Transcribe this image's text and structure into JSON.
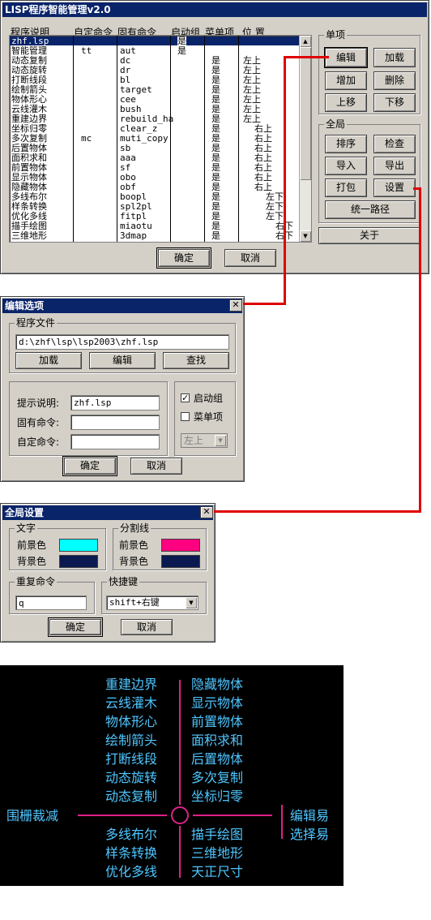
{
  "main": {
    "title": "LISP程序智能管理v2.0",
    "headers": [
      "程序说明",
      "自定命令",
      "固有命令",
      "启动组",
      "菜单项",
      "位 置"
    ],
    "rows": [
      {
        "desc": "zhf.lsp",
        "cmd": "",
        "builtin": "",
        "start": "是",
        "menu": "",
        "pos": ""
      },
      {
        "desc": "智能管理",
        "cmd": "tt",
        "builtin": "aut",
        "start": "是",
        "menu": "",
        "pos": ""
      },
      {
        "desc": "动态复制",
        "cmd": "",
        "builtin": "dc",
        "start": "",
        "menu": "是",
        "pos": "左上"
      },
      {
        "desc": "动态旋转",
        "cmd": "",
        "builtin": "dr",
        "start": "",
        "menu": "是",
        "pos": "左上"
      },
      {
        "desc": "打断线段",
        "cmd": "",
        "builtin": "bl",
        "start": "",
        "menu": "是",
        "pos": "左上"
      },
      {
        "desc": "绘制箭头",
        "cmd": "",
        "builtin": "target",
        "start": "",
        "menu": "是",
        "pos": "左上"
      },
      {
        "desc": "物体形心",
        "cmd": "",
        "builtin": "cee",
        "start": "",
        "menu": "是",
        "pos": "左上"
      },
      {
        "desc": "云线灌木",
        "cmd": "",
        "builtin": "bush",
        "start": "",
        "menu": "是",
        "pos": "左上"
      },
      {
        "desc": "重建边界",
        "cmd": "",
        "builtin": "rebuild_ha",
        "start": "",
        "menu": "是",
        "pos": "左上"
      },
      {
        "desc": "坐标归零",
        "cmd": "",
        "builtin": "clear_z",
        "start": "",
        "menu": "是",
        "pos": "右上"
      },
      {
        "desc": "多次复制",
        "cmd": "mc",
        "builtin": "muti_copy",
        "start": "",
        "menu": "是",
        "pos": "右上"
      },
      {
        "desc": "后置物体",
        "cmd": "",
        "builtin": "sb",
        "start": "",
        "menu": "是",
        "pos": "右上"
      },
      {
        "desc": "面积求和",
        "cmd": "",
        "builtin": "aaa",
        "start": "",
        "menu": "是",
        "pos": "右上"
      },
      {
        "desc": "前置物体",
        "cmd": "",
        "builtin": "sf",
        "start": "",
        "menu": "是",
        "pos": "右上"
      },
      {
        "desc": "显示物体",
        "cmd": "",
        "builtin": "obo",
        "start": "",
        "menu": "是",
        "pos": "右上"
      },
      {
        "desc": "隐藏物体",
        "cmd": "",
        "builtin": "obf",
        "start": "",
        "menu": "是",
        "pos": "右上"
      },
      {
        "desc": "多线布尔",
        "cmd": "",
        "builtin": "boopl",
        "start": "",
        "menu": "是",
        "pos": "左下"
      },
      {
        "desc": "样条转换",
        "cmd": "",
        "builtin": "spl2pl",
        "start": "",
        "menu": "是",
        "pos": "左下"
      },
      {
        "desc": "优化多线",
        "cmd": "",
        "builtin": "fitpl",
        "start": "",
        "menu": "是",
        "pos": "左下"
      },
      {
        "desc": "描手绘图",
        "cmd": "",
        "builtin": "miaotu",
        "start": "",
        "menu": "是",
        "pos": "右下"
      },
      {
        "desc": "三维地形",
        "cmd": "",
        "builtin": "3dmap",
        "start": "",
        "menu": "是",
        "pos": "右下"
      }
    ],
    "single_group": "单项",
    "single_buttons": [
      "编辑",
      "加载",
      "增加",
      "删除",
      "上移",
      "下移"
    ],
    "global_group": "全局",
    "global_buttons": [
      "排序",
      "检查",
      "导入",
      "导出",
      "打包",
      "设置"
    ],
    "unify_path": "统一路径",
    "about": "关于",
    "ok": "确定",
    "cancel": "取消"
  },
  "edit": {
    "title": "编辑选项",
    "file_group": "程序文件",
    "file_path": "d:\\zhf\\lsp\\lsp2003\\zhf.lsp",
    "btn_load": "加载",
    "btn_edit": "编辑",
    "btn_find": "查找",
    "lbl_desc": "提示说明:",
    "val_desc": "zhf.lsp",
    "lbl_builtin": "固有命令:",
    "val_builtin": "",
    "lbl_custom": "自定命令:",
    "val_custom": "",
    "chk_start": "启动组",
    "chk_start_checked": true,
    "chk_menu": "菜单项",
    "chk_menu_checked": false,
    "pos_select": "左上",
    "ok": "确定",
    "cancel": "取消"
  },
  "global": {
    "title": "全局设置",
    "text_group": "文字",
    "sep_group": "分割线",
    "fg_label": "前景色",
    "bg_label": "背景色",
    "text_fg": "#00ffff",
    "text_bg": "#0a1a50",
    "sep_fg": "#ff0080",
    "sep_bg": "#0a1a50",
    "repeat_group": "重复命令",
    "repeat_value": "q",
    "hotkey_group": "快捷键",
    "hotkey_value": "shift+右键",
    "ok": "确定",
    "cancel": "取消"
  },
  "menu": {
    "upper_left": [
      "重建边界",
      "云线灌木",
      "物体形心",
      "绘制箭头",
      "打断线段",
      "动态旋转",
      "动态复制"
    ],
    "upper_right": [
      "隐藏物体",
      "显示物体",
      "前置物体",
      "面积求和",
      "后置物体",
      "多次复制",
      "坐标归零"
    ],
    "left": "围栅裁减",
    "right": [
      "编辑易",
      "选择易"
    ],
    "lower_left": [
      "多线布尔",
      "样条转换",
      "优化多线"
    ],
    "lower_right": [
      "描手绘图",
      "三维地形",
      "天正尺寸"
    ],
    "text_color": "#4fc6ff",
    "line_color": "#e0208a"
  }
}
